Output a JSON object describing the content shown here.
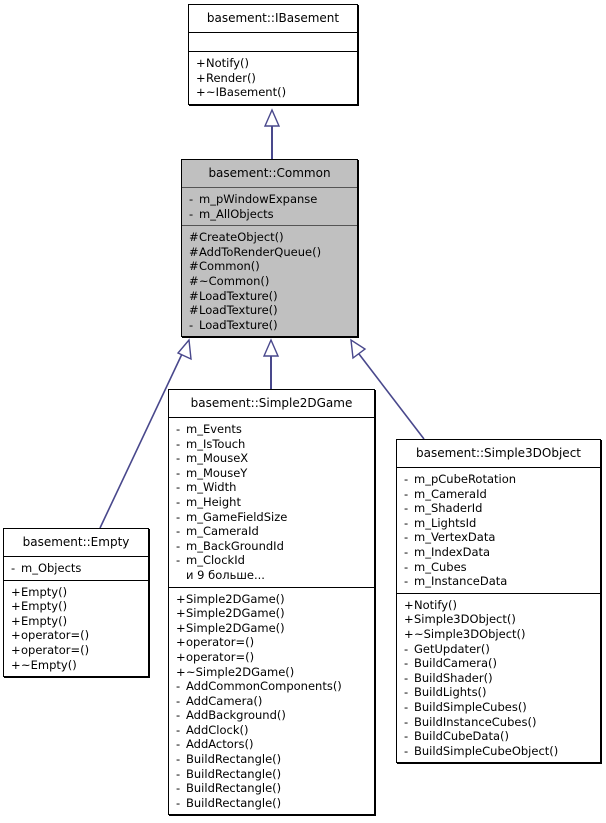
{
  "diagram": {
    "type": "uml-inheritance",
    "line_color": "#49488c",
    "highlight_color": "#c0c0c0",
    "border_color": "#000000",
    "background_color": "#ffffff",
    "classes": [
      {
        "id": "ibasement",
        "name": "basement::IBasement",
        "highlighted": false,
        "attributes": [],
        "methods": [
          {
            "visibility": "+",
            "name": "Notify()"
          },
          {
            "visibility": "+",
            "name": "Render()"
          },
          {
            "visibility": "+",
            "name": "~IBasement()"
          }
        ]
      },
      {
        "id": "common",
        "name": "basement::Common",
        "highlighted": true,
        "attributes": [
          {
            "visibility": "-",
            "name": "m_pWindowExpanse"
          },
          {
            "visibility": "-",
            "name": "m_AllObjects"
          }
        ],
        "methods": [
          {
            "visibility": "#",
            "name": "CreateObject()"
          },
          {
            "visibility": "#",
            "name": "AddToRenderQueue()"
          },
          {
            "visibility": "#",
            "name": "Common()"
          },
          {
            "visibility": "#",
            "name": "~Common()"
          },
          {
            "visibility": "#",
            "name": "LoadTexture()"
          },
          {
            "visibility": "#",
            "name": "LoadTexture()"
          },
          {
            "visibility": "-",
            "name": "LoadTexture()"
          }
        ]
      },
      {
        "id": "empty",
        "name": "basement::Empty",
        "highlighted": false,
        "attributes": [
          {
            "visibility": "-",
            "name": "m_Objects"
          }
        ],
        "methods": [
          {
            "visibility": "+",
            "name": "Empty()"
          },
          {
            "visibility": "+",
            "name": "Empty()"
          },
          {
            "visibility": "+",
            "name": "Empty()"
          },
          {
            "visibility": "+",
            "name": "operator=()"
          },
          {
            "visibility": "+",
            "name": "operator=()"
          },
          {
            "visibility": "+",
            "name": "~Empty()"
          }
        ]
      },
      {
        "id": "s2dgame",
        "name": "basement::Simple2DGame",
        "highlighted": false,
        "attributes": [
          {
            "visibility": "-",
            "name": "m_Events"
          },
          {
            "visibility": "-",
            "name": "m_IsTouch"
          },
          {
            "visibility": "-",
            "name": "m_MouseX"
          },
          {
            "visibility": "-",
            "name": "m_MouseY"
          },
          {
            "visibility": "-",
            "name": "m_Width"
          },
          {
            "visibility": "-",
            "name": "m_Height"
          },
          {
            "visibility": "-",
            "name": "m_GameFieldSize"
          },
          {
            "visibility": "-",
            "name": "m_CameraId"
          },
          {
            "visibility": "-",
            "name": "m_BackGroundId"
          },
          {
            "visibility": "-",
            "name": "m_ClockId"
          },
          {
            "visibility": "",
            "name": "и 9 больше..."
          }
        ],
        "methods": [
          {
            "visibility": "+",
            "name": "Simple2DGame()"
          },
          {
            "visibility": "+",
            "name": "Simple2DGame()"
          },
          {
            "visibility": "+",
            "name": "Simple2DGame()"
          },
          {
            "visibility": "+",
            "name": "operator=()"
          },
          {
            "visibility": "+",
            "name": "operator=()"
          },
          {
            "visibility": "+",
            "name": "~Simple2DGame()"
          },
          {
            "visibility": "-",
            "name": "AddCommonComponents()"
          },
          {
            "visibility": "-",
            "name": "AddCamera()"
          },
          {
            "visibility": "-",
            "name": "AddBackground()"
          },
          {
            "visibility": "-",
            "name": "AddClock()"
          },
          {
            "visibility": "-",
            "name": "AddActors()"
          },
          {
            "visibility": "-",
            "name": "BuildRectangle()"
          },
          {
            "visibility": "-",
            "name": "BuildRectangle()"
          },
          {
            "visibility": "-",
            "name": "BuildRectangle()"
          },
          {
            "visibility": "-",
            "name": "BuildRectangle()"
          }
        ]
      },
      {
        "id": "s3dobj",
        "name": "basement::Simple3DObject",
        "highlighted": false,
        "attributes": [
          {
            "visibility": "-",
            "name": "m_pCubeRotation"
          },
          {
            "visibility": "-",
            "name": "m_CameraId"
          },
          {
            "visibility": "-",
            "name": "m_ShaderId"
          },
          {
            "visibility": "-",
            "name": "m_LightsId"
          },
          {
            "visibility": "-",
            "name": "m_VertexData"
          },
          {
            "visibility": "-",
            "name": "m_IndexData"
          },
          {
            "visibility": "-",
            "name": "m_Cubes"
          },
          {
            "visibility": "-",
            "name": "m_InstanceData"
          }
        ],
        "methods": [
          {
            "visibility": "+",
            "name": "Notify()"
          },
          {
            "visibility": "+",
            "name": "Simple3DObject()"
          },
          {
            "visibility": "+",
            "name": "~Simple3DObject()"
          },
          {
            "visibility": "-",
            "name": "GetUpdater()"
          },
          {
            "visibility": "-",
            "name": "BuildCamera()"
          },
          {
            "visibility": "-",
            "name": "BuildShader()"
          },
          {
            "visibility": "-",
            "name": "BuildLights()"
          },
          {
            "visibility": "-",
            "name": "BuildSimpleCubes()"
          },
          {
            "visibility": "-",
            "name": "BuildInstanceCubes()"
          },
          {
            "visibility": "-",
            "name": "BuildCubeData()"
          },
          {
            "visibility": "-",
            "name": "BuildSimpleCubeObject()"
          }
        ]
      }
    ],
    "inheritance_edges": [
      {
        "from": "common",
        "to": "ibasement"
      },
      {
        "from": "empty",
        "to": "common"
      },
      {
        "from": "s2dgame",
        "to": "common"
      },
      {
        "from": "s3dobj",
        "to": "common"
      }
    ]
  }
}
